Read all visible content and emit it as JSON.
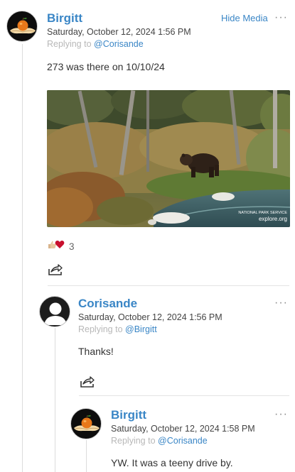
{
  "post1": {
    "author": "Birgitt",
    "timestamp": "Saturday, October 12, 2024 1:56 PM",
    "replying_prefix": "Replying to",
    "replying_to": "@Corisande",
    "hide_media_label": "Hide Media",
    "body": "273 was there on 10/10/24",
    "watermark_org": "NATIONAL PARK SERVICE",
    "watermark_site": "explore.org",
    "reaction_count": "3"
  },
  "post2": {
    "author": "Corisande",
    "timestamp": "Saturday, October 12, 2024 1:56 PM",
    "replying_prefix": "Replying to",
    "replying_to": "@Birgitt",
    "body": "Thanks!"
  },
  "post3": {
    "author": "Birgitt",
    "timestamp": "Saturday, October 12, 2024 1:58 PM",
    "replying_prefix": "Replying to",
    "replying_to": "@Corisande",
    "body": "YW. It was a teeny drive by."
  },
  "icons": {
    "more": "more-options-icon",
    "share": "share-icon",
    "reaction_thumb": "thumbs-up-icon",
    "reaction_heart": "heart-icon"
  },
  "colors": {
    "accent": "#3a86c6",
    "muted": "#b8b8b8",
    "heart": "#c8102e"
  },
  "more_glyph": "···"
}
